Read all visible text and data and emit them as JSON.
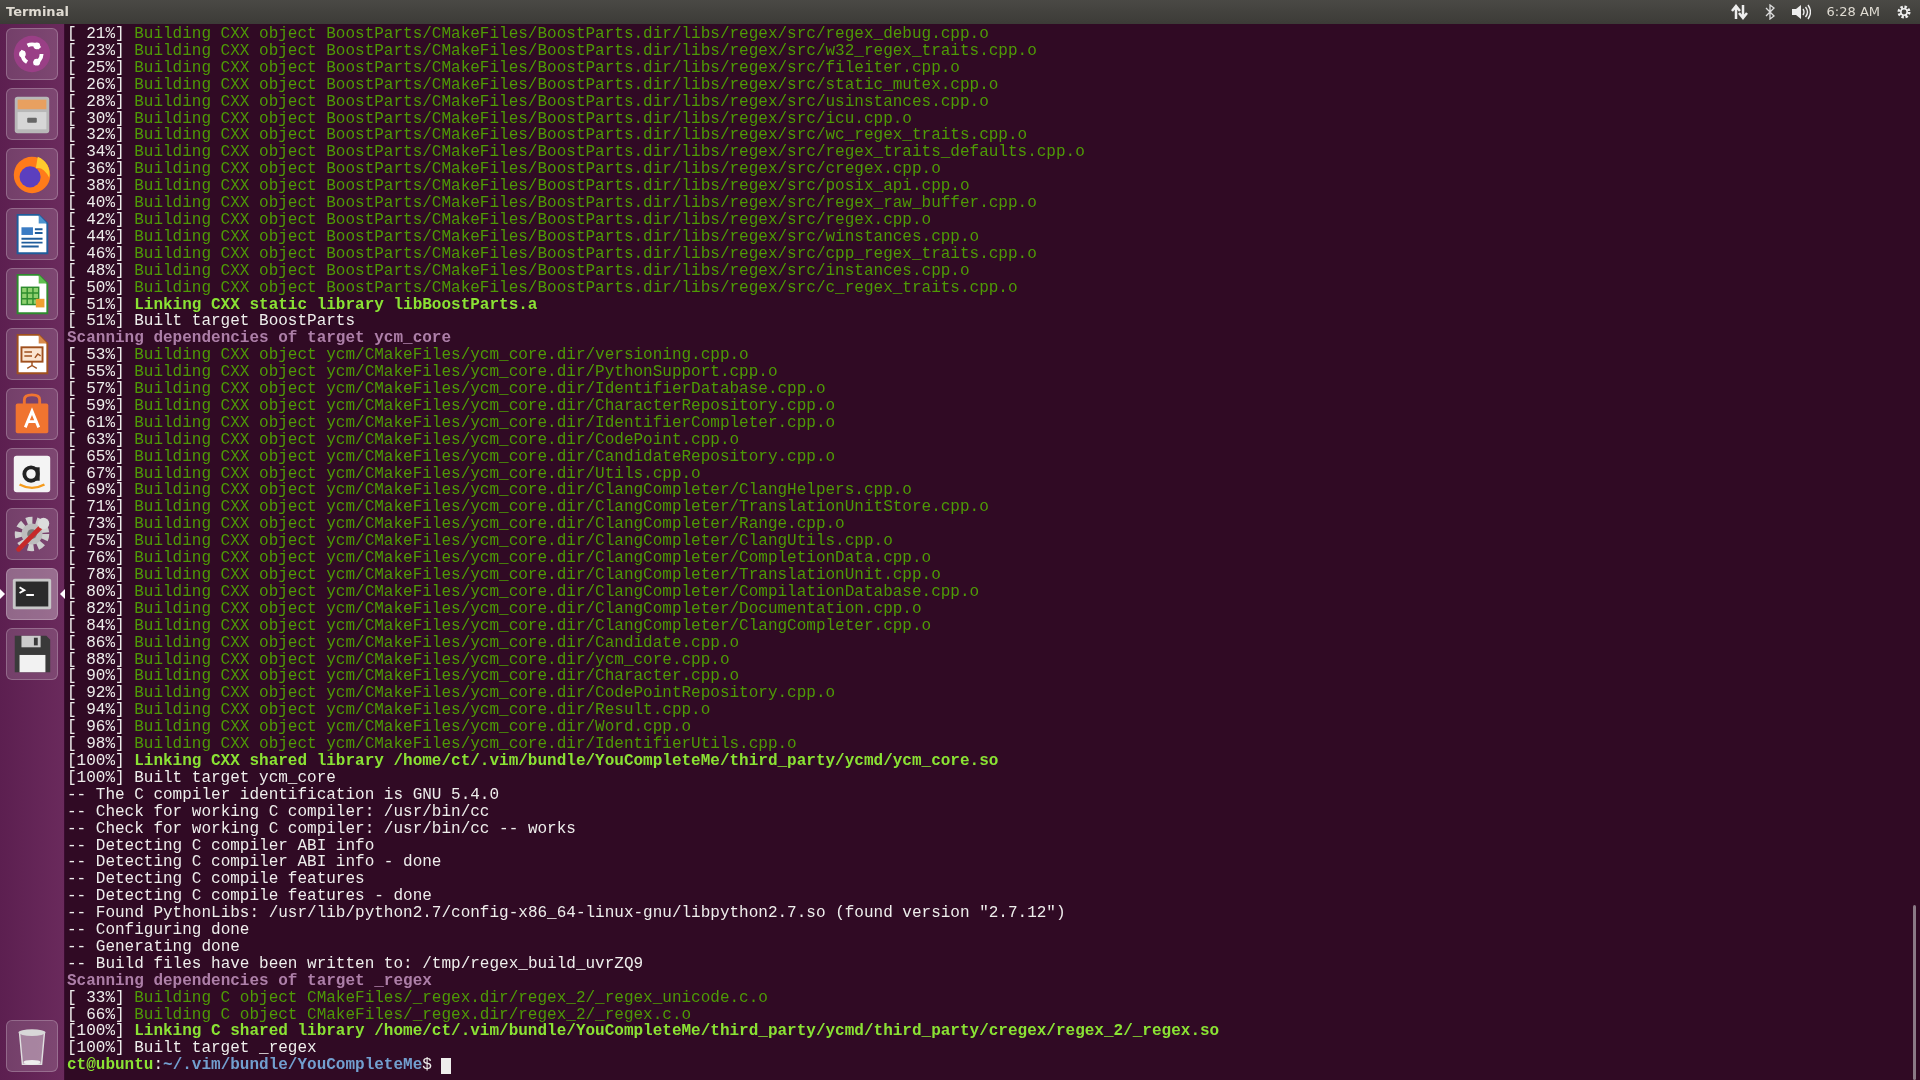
{
  "top_bar": {
    "title": "Terminal",
    "clock": "6:28 AM"
  },
  "launcher": {
    "items": [
      {
        "kind": "ubuntu",
        "active": false
      },
      {
        "kind": "files",
        "active": false
      },
      {
        "kind": "browser",
        "active": false
      },
      {
        "kind": "writer",
        "active": false
      },
      {
        "kind": "calc",
        "active": false
      },
      {
        "kind": "impress",
        "active": false
      },
      {
        "kind": "store",
        "active": false
      },
      {
        "kind": "amazon",
        "active": false
      },
      {
        "kind": "settings",
        "active": false
      },
      {
        "kind": "terminal",
        "active": true
      },
      {
        "kind": "floppy",
        "active": false
      }
    ],
    "bottom_items": [
      {
        "kind": "trash",
        "active": false
      }
    ]
  },
  "terminal": {
    "lines": [
      {
        "kind": "build",
        "percent": "[ 21%]",
        "text": "Building CXX object BoostParts/CMakeFiles/BoostParts.dir/libs/regex/src/regex_debug.cpp.o"
      },
      {
        "kind": "build",
        "percent": "[ 23%]",
        "text": "Building CXX object BoostParts/CMakeFiles/BoostParts.dir/libs/regex/src/w32_regex_traits.cpp.o"
      },
      {
        "kind": "build",
        "percent": "[ 25%]",
        "text": "Building CXX object BoostParts/CMakeFiles/BoostParts.dir/libs/regex/src/fileiter.cpp.o"
      },
      {
        "kind": "build",
        "percent": "[ 26%]",
        "text": "Building CXX object BoostParts/CMakeFiles/BoostParts.dir/libs/regex/src/static_mutex.cpp.o"
      },
      {
        "kind": "build",
        "percent": "[ 28%]",
        "text": "Building CXX object BoostParts/CMakeFiles/BoostParts.dir/libs/regex/src/usinstances.cpp.o"
      },
      {
        "kind": "build",
        "percent": "[ 30%]",
        "text": "Building CXX object BoostParts/CMakeFiles/BoostParts.dir/libs/regex/src/icu.cpp.o"
      },
      {
        "kind": "build",
        "percent": "[ 32%]",
        "text": "Building CXX object BoostParts/CMakeFiles/BoostParts.dir/libs/regex/src/wc_regex_traits.cpp.o"
      },
      {
        "kind": "build",
        "percent": "[ 34%]",
        "text": "Building CXX object BoostParts/CMakeFiles/BoostParts.dir/libs/regex/src/regex_traits_defaults.cpp.o"
      },
      {
        "kind": "build",
        "percent": "[ 36%]",
        "text": "Building CXX object BoostParts/CMakeFiles/BoostParts.dir/libs/regex/src/cregex.cpp.o"
      },
      {
        "kind": "build",
        "percent": "[ 38%]",
        "text": "Building CXX object BoostParts/CMakeFiles/BoostParts.dir/libs/regex/src/posix_api.cpp.o"
      },
      {
        "kind": "build",
        "percent": "[ 40%]",
        "text": "Building CXX object BoostParts/CMakeFiles/BoostParts.dir/libs/regex/src/regex_raw_buffer.cpp.o"
      },
      {
        "kind": "build",
        "percent": "[ 42%]",
        "text": "Building CXX object BoostParts/CMakeFiles/BoostParts.dir/libs/regex/src/regex.cpp.o"
      },
      {
        "kind": "build",
        "percent": "[ 44%]",
        "text": "Building CXX object BoostParts/CMakeFiles/BoostParts.dir/libs/regex/src/winstances.cpp.o"
      },
      {
        "kind": "build",
        "percent": "[ 46%]",
        "text": "Building CXX object BoostParts/CMakeFiles/BoostParts.dir/libs/regex/src/cpp_regex_traits.cpp.o"
      },
      {
        "kind": "build",
        "percent": "[ 48%]",
        "text": "Building CXX object BoostParts/CMakeFiles/BoostParts.dir/libs/regex/src/instances.cpp.o"
      },
      {
        "kind": "build",
        "percent": "[ 50%]",
        "text": "Building CXX object BoostParts/CMakeFiles/BoostParts.dir/libs/regex/src/c_regex_traits.cpp.o"
      },
      {
        "kind": "link",
        "percent": "[ 51%]",
        "text": "Linking CXX static library libBoostParts.a"
      },
      {
        "kind": "status",
        "percent": "[ 51%]",
        "text": "Built target BoostParts"
      },
      {
        "kind": "scan",
        "text": "Scanning dependencies of target ycm_core"
      },
      {
        "kind": "build",
        "percent": "[ 53%]",
        "text": "Building CXX object ycm/CMakeFiles/ycm_core.dir/versioning.cpp.o"
      },
      {
        "kind": "build",
        "percent": "[ 55%]",
        "text": "Building CXX object ycm/CMakeFiles/ycm_core.dir/PythonSupport.cpp.o"
      },
      {
        "kind": "build",
        "percent": "[ 57%]",
        "text": "Building CXX object ycm/CMakeFiles/ycm_core.dir/IdentifierDatabase.cpp.o"
      },
      {
        "kind": "build",
        "percent": "[ 59%]",
        "text": "Building CXX object ycm/CMakeFiles/ycm_core.dir/CharacterRepository.cpp.o"
      },
      {
        "kind": "build",
        "percent": "[ 61%]",
        "text": "Building CXX object ycm/CMakeFiles/ycm_core.dir/IdentifierCompleter.cpp.o"
      },
      {
        "kind": "build",
        "percent": "[ 63%]",
        "text": "Building CXX object ycm/CMakeFiles/ycm_core.dir/CodePoint.cpp.o"
      },
      {
        "kind": "build",
        "percent": "[ 65%]",
        "text": "Building CXX object ycm/CMakeFiles/ycm_core.dir/CandidateRepository.cpp.o"
      },
      {
        "kind": "build",
        "percent": "[ 67%]",
        "text": "Building CXX object ycm/CMakeFiles/ycm_core.dir/Utils.cpp.o"
      },
      {
        "kind": "build",
        "percent": "[ 69%]",
        "text": "Building CXX object ycm/CMakeFiles/ycm_core.dir/ClangCompleter/ClangHelpers.cpp.o"
      },
      {
        "kind": "build",
        "percent": "[ 71%]",
        "text": "Building CXX object ycm/CMakeFiles/ycm_core.dir/ClangCompleter/TranslationUnitStore.cpp.o"
      },
      {
        "kind": "build",
        "percent": "[ 73%]",
        "text": "Building CXX object ycm/CMakeFiles/ycm_core.dir/ClangCompleter/Range.cpp.o"
      },
      {
        "kind": "build",
        "percent": "[ 75%]",
        "text": "Building CXX object ycm/CMakeFiles/ycm_core.dir/ClangCompleter/ClangUtils.cpp.o"
      },
      {
        "kind": "build",
        "percent": "[ 76%]",
        "text": "Building CXX object ycm/CMakeFiles/ycm_core.dir/ClangCompleter/CompletionData.cpp.o"
      },
      {
        "kind": "build",
        "percent": "[ 78%]",
        "text": "Building CXX object ycm/CMakeFiles/ycm_core.dir/ClangCompleter/TranslationUnit.cpp.o"
      },
      {
        "kind": "build",
        "percent": "[ 80%]",
        "text": "Building CXX object ycm/CMakeFiles/ycm_core.dir/ClangCompleter/CompilationDatabase.cpp.o"
      },
      {
        "kind": "build",
        "percent": "[ 82%]",
        "text": "Building CXX object ycm/CMakeFiles/ycm_core.dir/ClangCompleter/Documentation.cpp.o"
      },
      {
        "kind": "build",
        "percent": "[ 84%]",
        "text": "Building CXX object ycm/CMakeFiles/ycm_core.dir/ClangCompleter/ClangCompleter.cpp.o"
      },
      {
        "kind": "build",
        "percent": "[ 86%]",
        "text": "Building CXX object ycm/CMakeFiles/ycm_core.dir/Candidate.cpp.o"
      },
      {
        "kind": "build",
        "percent": "[ 88%]",
        "text": "Building CXX object ycm/CMakeFiles/ycm_core.dir/ycm_core.cpp.o"
      },
      {
        "kind": "build",
        "percent": "[ 90%]",
        "text": "Building CXX object ycm/CMakeFiles/ycm_core.dir/Character.cpp.o"
      },
      {
        "kind": "build",
        "percent": "[ 92%]",
        "text": "Building CXX object ycm/CMakeFiles/ycm_core.dir/CodePointRepository.cpp.o"
      },
      {
        "kind": "build",
        "percent": "[ 94%]",
        "text": "Building CXX object ycm/CMakeFiles/ycm_core.dir/Result.cpp.o"
      },
      {
        "kind": "build",
        "percent": "[ 96%]",
        "text": "Building CXX object ycm/CMakeFiles/ycm_core.dir/Word.cpp.o"
      },
      {
        "kind": "build",
        "percent": "[ 98%]",
        "text": "Building CXX object ycm/CMakeFiles/ycm_core.dir/IdentifierUtils.cpp.o"
      },
      {
        "kind": "link",
        "percent": "[100%]",
        "text": "Linking CXX shared library /home/ct/.vim/bundle/YouCompleteMe/third_party/ycmd/ycm_core.so"
      },
      {
        "kind": "status",
        "percent": "[100%]",
        "text": "Built target ycm_core"
      },
      {
        "kind": "info",
        "text": "-- The C compiler identification is GNU 5.4.0"
      },
      {
        "kind": "info",
        "text": "-- Check for working C compiler: /usr/bin/cc"
      },
      {
        "kind": "info",
        "text": "-- Check for working C compiler: /usr/bin/cc -- works"
      },
      {
        "kind": "info",
        "text": "-- Detecting C compiler ABI info"
      },
      {
        "kind": "info",
        "text": "-- Detecting C compiler ABI info - done"
      },
      {
        "kind": "info",
        "text": "-- Detecting C compile features"
      },
      {
        "kind": "info",
        "text": "-- Detecting C compile features - done"
      },
      {
        "kind": "info",
        "text": "-- Found PythonLibs: /usr/lib/python2.7/config-x86_64-linux-gnu/libpython2.7.so (found version \"2.7.12\")"
      },
      {
        "kind": "info",
        "text": "-- Configuring done"
      },
      {
        "kind": "info",
        "text": "-- Generating done"
      },
      {
        "kind": "info",
        "text": "-- Build files have been written to: /tmp/regex_build_uvrZQ9"
      },
      {
        "kind": "scan",
        "text": "Scanning dependencies of target _regex"
      },
      {
        "kind": "build",
        "percent": "[ 33%]",
        "text": "Building C object CMakeFiles/_regex.dir/regex_2/_regex_unicode.c.o"
      },
      {
        "kind": "build",
        "percent": "[ 66%]",
        "text": "Building C object CMakeFiles/_regex.dir/regex_2/_regex.c.o"
      },
      {
        "kind": "link",
        "percent": "[100%]",
        "text": "Linking C shared library /home/ct/.vim/bundle/YouCompleteMe/third_party/ycmd/third_party/cregex/regex_2/_regex.so"
      },
      {
        "kind": "status",
        "percent": "[100%]",
        "text": "Built target _regex"
      }
    ],
    "prompt": {
      "user_host": "ct@ubuntu",
      "separator": ":",
      "path": "~/.vim/bundle/YouCompleteMe",
      "symbol": "$"
    }
  }
}
